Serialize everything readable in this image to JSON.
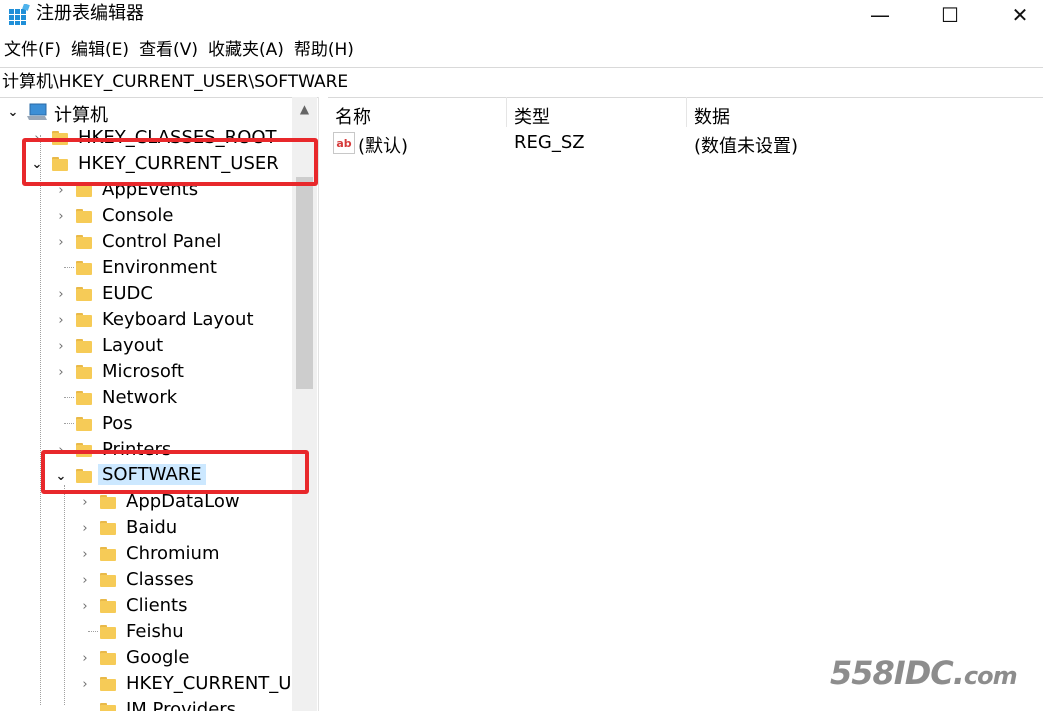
{
  "window": {
    "title": "注册表编辑器",
    "minimize": "—",
    "maximize": "☐",
    "close": "✕"
  },
  "menu": [
    "文件(F)",
    "编辑(E)",
    "查看(V)",
    "收藏夹(A)",
    "帮助(H)"
  ],
  "address": "计算机\\HKEY_CURRENT_USER\\SOFTWARE",
  "tree": {
    "root": "计算机",
    "hkcr": "HKEY_CLASSES_ROOT",
    "hkcu": "HKEY_CURRENT_USER",
    "hkcu_children": [
      "AppEvents",
      "Console",
      "Control Panel",
      "Environment",
      "EUDC",
      "Keyboard Layout",
      "Layout",
      "Microsoft",
      "Network",
      "Pos",
      "Printers",
      "SOFTWARE"
    ],
    "software_children": [
      "AppDataLow",
      "Baidu",
      "Chromium",
      "Classes",
      "Clients",
      "Feishu",
      "Google",
      "HKEY_CURRENT_US",
      "IM Providers"
    ]
  },
  "columns": {
    "name": "名称",
    "type": "类型",
    "data": "数据"
  },
  "values": [
    {
      "icon": "ab",
      "name": "(默认)",
      "type": "REG_SZ",
      "data": "(数值未设置)"
    }
  ],
  "watermark": {
    "main": "558IDC.",
    "suffix": "com"
  },
  "colors": {
    "highlight": "#e8282b",
    "selection": "#cce8ff",
    "folder": "#f6cb57"
  }
}
